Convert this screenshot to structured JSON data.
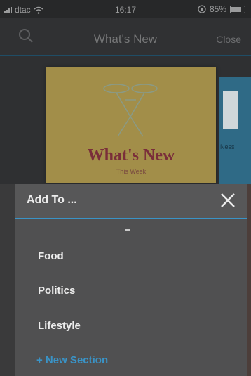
{
  "status_bar": {
    "carrier": "dtac",
    "time": "16:17",
    "battery": "85%",
    "battery_level": 0.85
  },
  "nav": {
    "title": "What's New",
    "close_label": "Close"
  },
  "cover": {
    "title": "What's New",
    "subtitle": "This Week"
  },
  "side_card": {
    "label": "Ness"
  },
  "sheet": {
    "title": "Add To ...",
    "items": [
      {
        "label": "Food"
      },
      {
        "label": "Politics"
      },
      {
        "label": "Lifestyle"
      }
    ],
    "new_section": "+ New Section"
  },
  "colors": {
    "accent": "#3a93c6",
    "sheet_bg": "#505051",
    "cover_bg": "#a28e49"
  }
}
